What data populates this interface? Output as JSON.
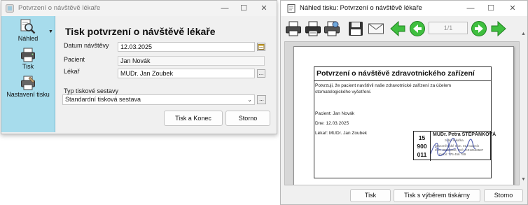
{
  "dialog": {
    "title": "Potvrzení o návštěvě lékaře",
    "sidebar": {
      "preview_label": "Náhled",
      "print_label": "Tisk",
      "settings_label": "Nastavení tisku"
    },
    "heading": "Tisk potvrzení o návštěvě lékaře",
    "fields": {
      "visit_date_label": "Datum návštěvy",
      "visit_date_value": "12.03.2025",
      "patient_label": "Pacient",
      "patient_value": "Jan Novák",
      "doctor_label": "Lékař",
      "doctor_value": "MUDr. Jan Zoubek",
      "report_type_label": "Typ tiskové sestavy",
      "report_type_value": "Standardní tisková sestava"
    },
    "buttons": {
      "print_and_close": "Tisk a Konec",
      "cancel": "Storno"
    }
  },
  "preview_window": {
    "title": "Náhled tisku: Potvrzení o návštěvě lékaře",
    "page_indicator": "1/1",
    "document": {
      "title": "Potvrzení o návštěvě zdravotnického zařízení",
      "body_line1": "Potvrzuji, že pacient navštívil naše zdravotnické zařízení za účelem",
      "body_line2": "stomatologického vyšetření.",
      "patient_line": "Pacient: Jan Novák",
      "date_line": "Dne: 12.03.2025",
      "doctor_line": "Lékař: MUDr. Jan Zoubek",
      "stamp": {
        "number_line1": "15",
        "number_line2": "900",
        "number_line3": "011",
        "doctor_name": "MUDr. Petra ŠTĚPÁNKOVÁ",
        "subtitle": "zubní lékařka",
        "address_line1": "Staroměstské nám. 01 Hodonín",
        "address_line2": "IČO: 00000000, DIČ: CZ12536587",
        "address_line3": "mobil: 775 456 789"
      }
    },
    "buttons": {
      "print": "Tisk",
      "print_with_selection": "Tisk s výběrem tiskárny",
      "cancel": "Storno"
    }
  },
  "colors": {
    "sidebar": "#a7dcec",
    "nav_arrow_green": "#3fbf3f",
    "stamp_ink": "#2f3f9f"
  }
}
